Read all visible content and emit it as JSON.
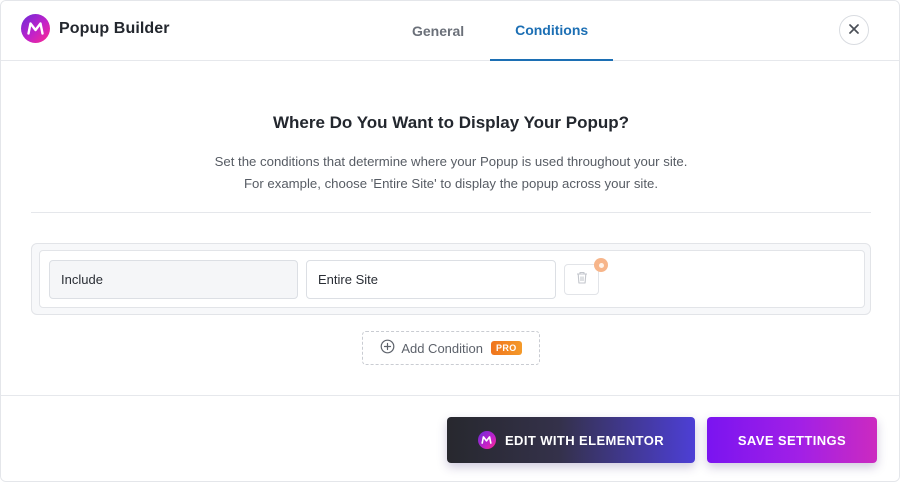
{
  "header": {
    "title": "Popup Builder",
    "logo_icon": "m-logo-icon",
    "tabs": [
      {
        "label": "General",
        "active": false
      },
      {
        "label": "Conditions",
        "active": true
      }
    ],
    "close_icon": "close-icon"
  },
  "main": {
    "heading": "Where Do You Want to Display Your Popup?",
    "description_line1": "Set the conditions that determine where your Popup is used throughout your site.",
    "description_line2": "For example, choose 'Entire Site' to display the popup across your site.",
    "condition": {
      "type_value": "Include",
      "target_value": "Entire Site",
      "delete_icon": "trash-icon"
    },
    "add_condition": {
      "label": "Add Condition",
      "badge": "PRO",
      "icon": "plus-circle-icon"
    }
  },
  "footer": {
    "edit_button": "EDIT WITH ELEMENTOR",
    "save_button": "SAVE SETTINGS"
  },
  "colors": {
    "accent_tab": "#1c6fb4",
    "save_gradient_start": "#7a14f0",
    "save_gradient_end": "#cc2ac0",
    "pro_badge": "#f0741d"
  }
}
